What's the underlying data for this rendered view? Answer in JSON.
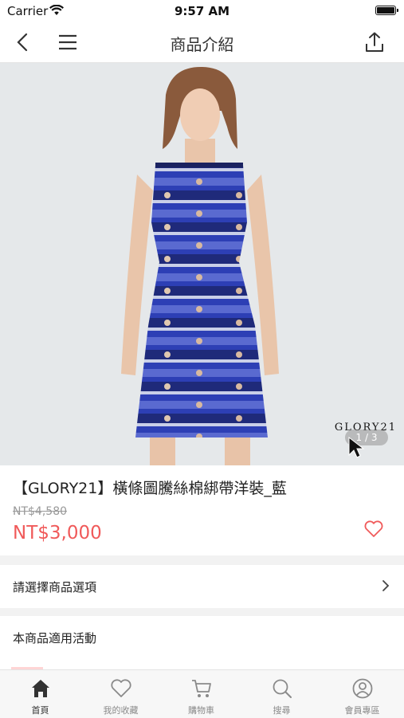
{
  "status_bar": {
    "carrier": "Carrier",
    "time": "9:57 AM"
  },
  "nav": {
    "title": "商品介紹"
  },
  "product": {
    "name": "【GLORY21】橫條圖騰絲棉綁帶洋裝_藍",
    "original_price": "NT$4,580",
    "price": "NT$3,000",
    "brand_watermark": "GLORY21",
    "image_pager": "1 / 3"
  },
  "rows": {
    "options": "請選擇商品選項",
    "promotions": "本商品適用活動"
  },
  "tabbar": [
    {
      "label": "首頁",
      "icon": "home-icon",
      "active": true
    },
    {
      "label": "我的收藏",
      "icon": "heart-icon",
      "active": false
    },
    {
      "label": "購物車",
      "icon": "cart-icon",
      "active": false
    },
    {
      "label": "搜尋",
      "icon": "search-icon",
      "active": false
    },
    {
      "label": "會員專區",
      "icon": "user-icon",
      "active": false
    }
  ],
  "colors": {
    "price": "#f05a5a",
    "accent": "#f05a5a"
  }
}
